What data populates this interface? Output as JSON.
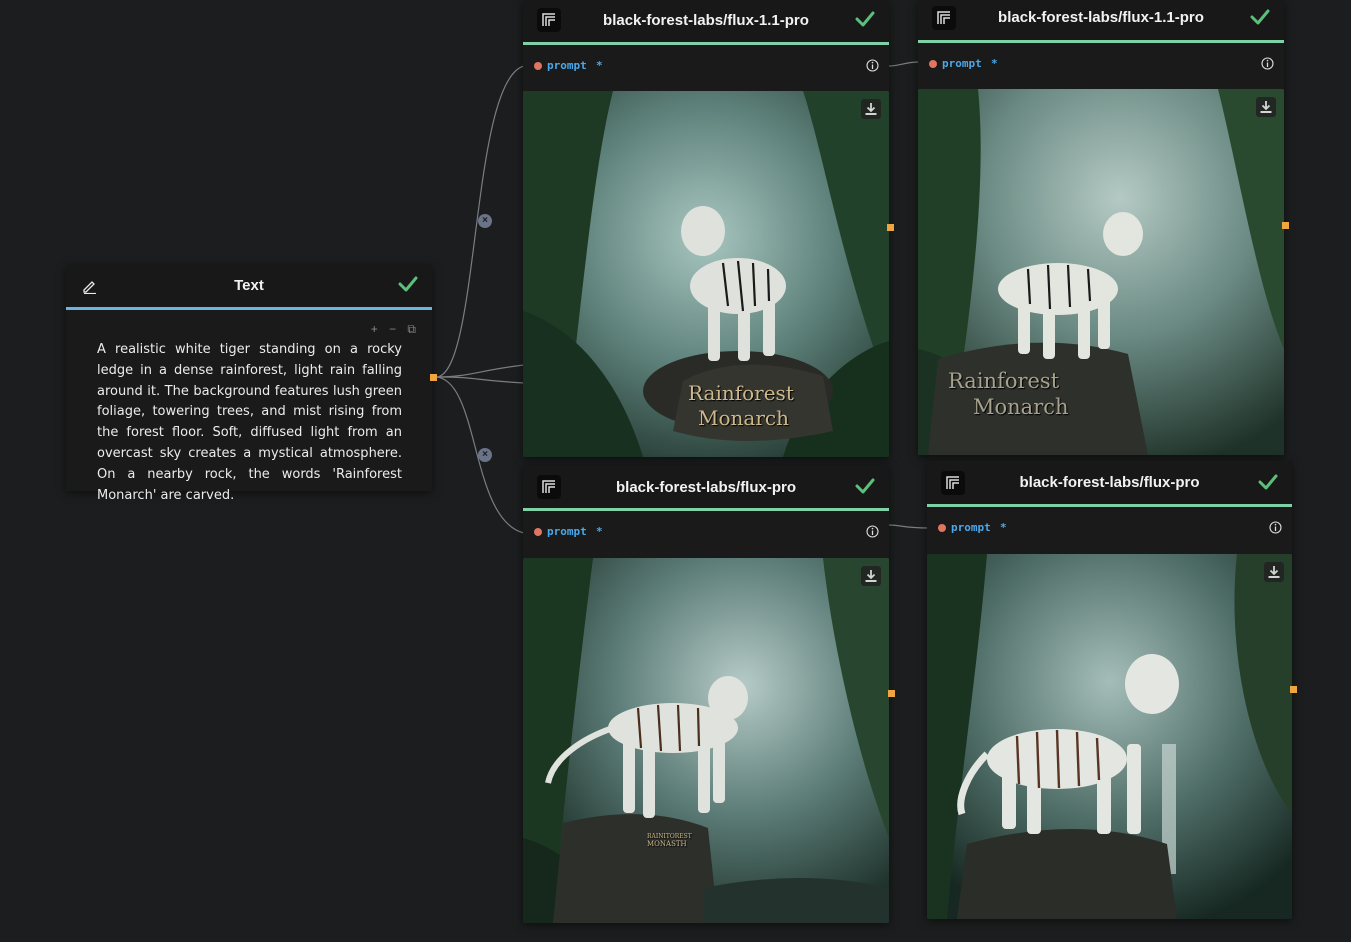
{
  "text_node": {
    "title": "Text",
    "content": "A realistic white tiger standing on a rocky ledge in a dense rainforest, light rain falling around it. The background features lush green foliage, towering trees, and mist rising from the forest floor. Soft, diffused light from an overcast sky creates a mystical atmosphere. On a nearby rock, the words 'Rainforest Monarch' are carved.",
    "tools": "+ − ⧉"
  },
  "model_nodes": [
    {
      "title": "black-forest-labs/flux-1.1-pro",
      "input_label": "prompt",
      "required_mark": "*",
      "carved_text_1": "Rainforest",
      "carved_text_2": "Monarch"
    },
    {
      "title": "black-forest-labs/flux-1.1-pro",
      "input_label": "prompt",
      "required_mark": "*",
      "carved_text_1": "Rainforest",
      "carved_text_2": "Monarch"
    },
    {
      "title": "black-forest-labs/flux-pro",
      "input_label": "prompt",
      "required_mark": "*",
      "carved_text_1": "RAINITOREST",
      "carved_text_2": "MONASTH"
    },
    {
      "title": "black-forest-labs/flux-pro",
      "input_label": "prompt",
      "required_mark": "*"
    }
  ],
  "colors": {
    "background": "#1b1d1e",
    "node_bg": "#1a1a1b",
    "accent_green": "#7fd1a8",
    "accent_blue": "#6bb6de",
    "port_orange": "#f0a640",
    "input_label": "#4aa8e8",
    "input_dot": "#e07560",
    "check": "#5cbf7c"
  },
  "icons": {
    "edit": "pencil-icon",
    "status": "checkmark-icon",
    "model": "model-logo-icon",
    "info": "info-icon",
    "download": "download-icon",
    "edge_remove": "close-icon"
  }
}
